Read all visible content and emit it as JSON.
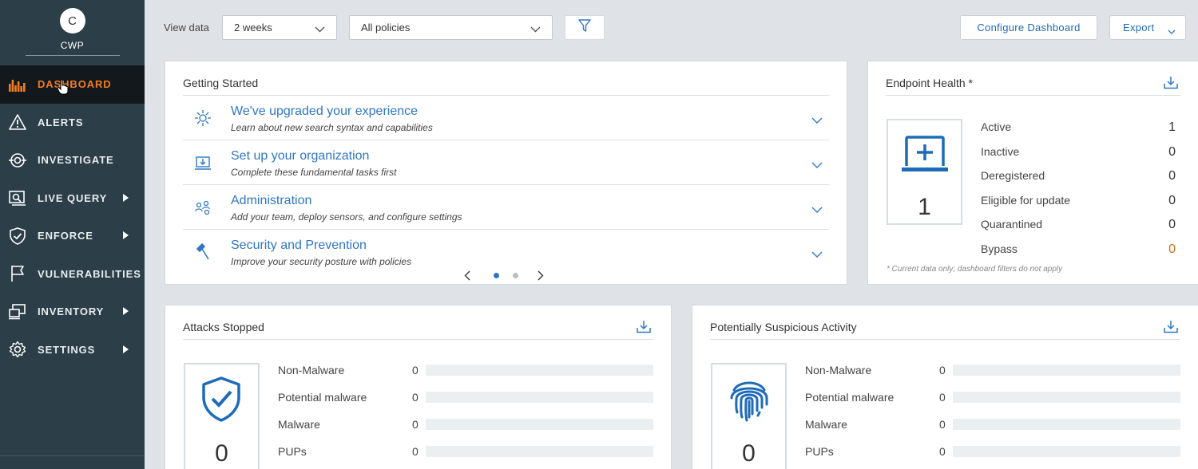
{
  "sidebar": {
    "avatar_initial": "C",
    "org_name": "CWP",
    "items": [
      {
        "label": "DASHBOARD",
        "icon": "bar-chart-icon",
        "active": true
      },
      {
        "label": "ALERTS",
        "icon": "warning-icon"
      },
      {
        "label": "INVESTIGATE",
        "icon": "crosshair-icon"
      },
      {
        "label": "LIVE QUERY",
        "icon": "live-query-icon",
        "has_submenu": true
      },
      {
        "label": "ENFORCE",
        "icon": "shield-check-icon",
        "has_submenu": true
      },
      {
        "label": "VULNERABILITIES",
        "icon": "flag-icon"
      },
      {
        "label": "INVENTORY",
        "icon": "devices-icon",
        "has_submenu": true
      },
      {
        "label": "SETTINGS",
        "icon": "gear-icon",
        "has_submenu": true
      }
    ]
  },
  "toolbar": {
    "view_label": "View data",
    "period_value": "2 weeks",
    "policy_value": "All policies",
    "configure_label": "Configure Dashboard",
    "export_label": "Export"
  },
  "getting_started": {
    "title": "Getting Started",
    "items": [
      {
        "title": "We've upgraded your experience",
        "subtitle": "Learn about new search syntax and capabilities",
        "icon": "sparkle-icon"
      },
      {
        "title": "Set up your organization",
        "subtitle": "Complete these fundamental tasks first",
        "icon": "laptop-download-icon"
      },
      {
        "title": "Administration",
        "subtitle": "Add your team, deploy sensors, and configure settings",
        "icon": "team-icon"
      },
      {
        "title": "Security and Prevention",
        "subtitle": "Improve your security posture with policies",
        "icon": "gavel-icon"
      }
    ],
    "page_current": 1,
    "page_total": 2
  },
  "endpoint_health": {
    "title": "Endpoint Health *",
    "total": "1",
    "rows": [
      {
        "label": "Active",
        "value": "1"
      },
      {
        "label": "Inactive",
        "value": "0"
      },
      {
        "label": "Deregistered",
        "value": "0"
      },
      {
        "label": "Eligible for update",
        "value": "0"
      },
      {
        "label": "Quarantined",
        "value": "0"
      },
      {
        "label": "Bypass",
        "value": "0"
      }
    ],
    "note": "* Current data only; dashboard filters do not apply"
  },
  "attacks_stopped": {
    "title": "Attacks Stopped",
    "total": "0",
    "rows": [
      {
        "label": "Non-Malware",
        "value": "0"
      },
      {
        "label": "Potential malware",
        "value": "0"
      },
      {
        "label": "Malware",
        "value": "0"
      },
      {
        "label": "PUPs",
        "value": "0"
      }
    ]
  },
  "suspicious_activity": {
    "title": "Potentially Suspicious Activity",
    "total": "0",
    "rows": [
      {
        "label": "Non-Malware",
        "value": "0"
      },
      {
        "label": "Potential malware",
        "value": "0"
      },
      {
        "label": "Malware",
        "value": "0"
      },
      {
        "label": "PUPs",
        "value": "0"
      }
    ]
  },
  "colors": {
    "sidebar_bg": "#2c3e48",
    "active_bg": "#13181c",
    "accent_orange": "#f47c20",
    "link_blue": "#2f77c4",
    "page_bg": "#dfe3e7"
  }
}
